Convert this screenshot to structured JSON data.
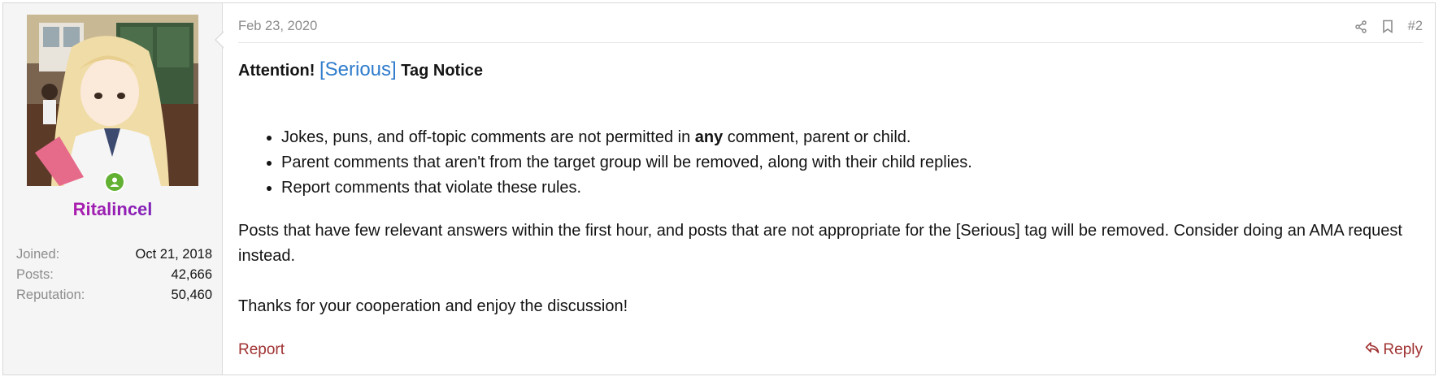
{
  "user": {
    "username": "Ritalincel",
    "stats": [
      {
        "label": "Joined:",
        "value": "Oct 21, 2018"
      },
      {
        "label": "Posts:",
        "value": "42,666"
      },
      {
        "label": "Reputation:",
        "value": "50,460"
      }
    ],
    "online_color": "#63b132"
  },
  "post": {
    "date": "Feb 23, 2020",
    "number": "#2",
    "icons": [
      "share-icon",
      "bookmark-icon"
    ],
    "title_prefix": "Attention!",
    "title_tag": "[Serious]",
    "title_suffix": "Tag Notice",
    "rules": [
      {
        "before": "Jokes, puns, and off-topic comments are not permitted in ",
        "bold": "any",
        "after": " comment, parent or child."
      },
      {
        "before": "Parent comments that aren't from the target group will be removed, along with their child replies.",
        "bold": "",
        "after": ""
      },
      {
        "before": "Report comments that violate these rules.",
        "bold": "",
        "after": ""
      }
    ],
    "paragraph1": "Posts that have few relevant answers within the first hour, and posts that are not appropriate for the [Serious] tag will be removed. Consider doing an AMA request instead.",
    "paragraph2": "Thanks for your cooperation and enjoy the discussion!",
    "report_label": "Report",
    "reply_label": "Reply",
    "link_color": "#a03232",
    "tag_color": "#2f7ccc"
  }
}
